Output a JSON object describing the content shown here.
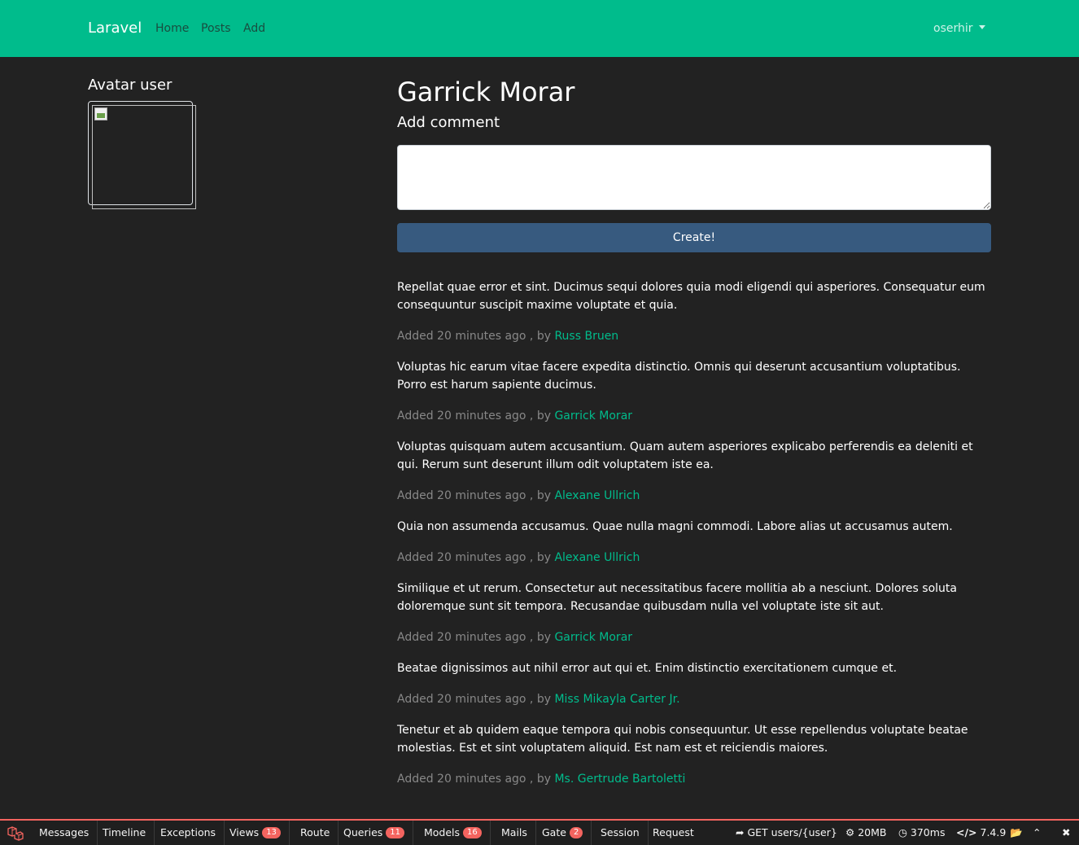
{
  "navbar": {
    "brand": "Laravel",
    "links": [
      "Home",
      "Posts",
      "Add"
    ],
    "user": "oserhir"
  },
  "sidebar": {
    "avatar_title": "Avatar user"
  },
  "profile": {
    "name": "Garrick Morar",
    "add_comment_label": "Add comment",
    "create_button": "Create!"
  },
  "comments": [
    {
      "text": "Repellat quae error et sint. Ducimus sequi dolores quia modi eligendi qui asperiores. Consequatur eum consequuntur suscipit maxime voluptate et quia.",
      "meta": "Added 20 minutes ago , by ",
      "author": "Russ Bruen"
    },
    {
      "text": "Voluptas hic earum vitae facere expedita distinctio. Omnis qui deserunt accusantium voluptatibus. Porro est harum sapiente ducimus.",
      "meta": "Added 20 minutes ago , by ",
      "author": "Garrick Morar"
    },
    {
      "text": "Voluptas quisquam autem accusantium. Quam autem asperiores explicabo perferendis ea deleniti et qui. Rerum sunt deserunt illum odit voluptatem iste ea.",
      "meta": "Added 20 minutes ago , by ",
      "author": "Alexane Ullrich"
    },
    {
      "text": "Quia non assumenda accusamus. Quae nulla magni commodi. Labore alias ut accusamus autem.",
      "meta": "Added 20 minutes ago , by ",
      "author": "Alexane Ullrich"
    },
    {
      "text": "Similique et ut rerum. Consectetur aut necessitatibus facere mollitia ab a nesciunt. Dolores soluta doloremque sunt sit tempora. Recusandae quibusdam nulla vel voluptate iste sit aut.",
      "meta": "Added 20 minutes ago , by ",
      "author": "Garrick Morar"
    },
    {
      "text": "Beatae dignissimos aut nihil error aut qui et. Enim distinctio exercitationem cumque et.",
      "meta": "Added 20 minutes ago , by ",
      "author": "Miss Mikayla Carter Jr."
    },
    {
      "text": "Tenetur et ab quidem eaque tempora qui nobis consequuntur. Ut esse repellendus voluptate beatae molestias. Est et sint voluptatem aliquid. Est nam est et reiciendis maiores.",
      "meta": "Added 20 minutes ago , by ",
      "author": "Ms. Gertrude Bartoletti"
    }
  ],
  "debugbar": {
    "tabs": [
      {
        "label": "Messages",
        "badge": ""
      },
      {
        "label": "Timeline",
        "badge": ""
      },
      {
        "label": "Exceptions",
        "badge": ""
      },
      {
        "label": "Views",
        "badge": "13"
      },
      {
        "label": "Route",
        "badge": ""
      },
      {
        "label": "Queries",
        "badge": "11"
      },
      {
        "label": "Models",
        "badge": "16"
      },
      {
        "label": "Mails",
        "badge": ""
      },
      {
        "label": "Gate",
        "badge": "2"
      },
      {
        "label": "Session",
        "badge": ""
      },
      {
        "label": "Request",
        "badge": ""
      }
    ],
    "route": "GET users/{user}",
    "memory": "20MB",
    "time": "370ms",
    "php_version": "7.4.9"
  },
  "colors": {
    "navbar": "#00bc8c",
    "background": "#222222",
    "button": "#375a7f",
    "link": "#00bc8c",
    "badge": "#f4645f"
  }
}
